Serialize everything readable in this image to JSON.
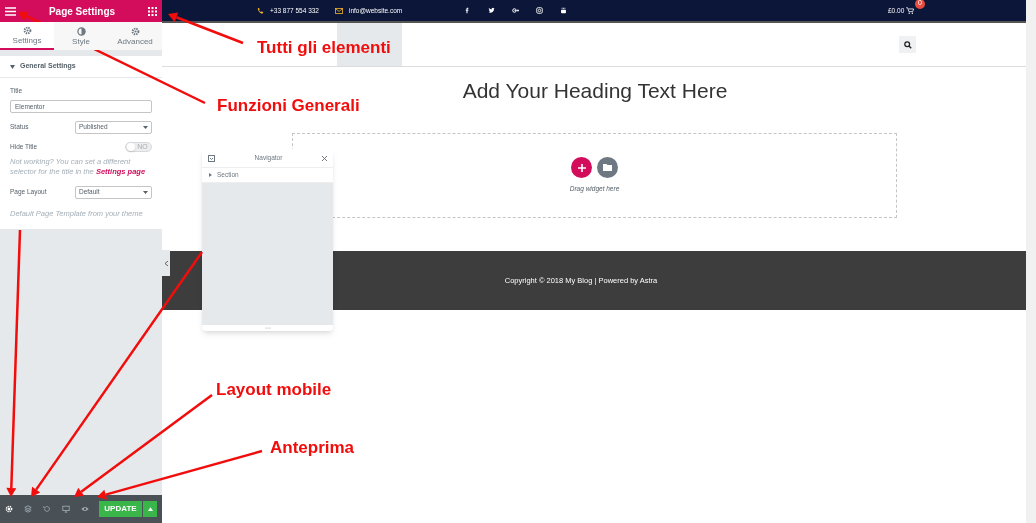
{
  "panel": {
    "title": "Page Settings",
    "tabs": [
      {
        "label": "Settings",
        "selected": true
      },
      {
        "label": "Style",
        "selected": false
      },
      {
        "label": "Advanced",
        "selected": false
      }
    ],
    "section_title": "General Settings",
    "fields": [
      {
        "kind": "text",
        "label": "Title",
        "value": "Elementor"
      },
      {
        "kind": "select",
        "label": "Status",
        "value": "Published"
      },
      {
        "kind": "toggle",
        "label": "Hide Title",
        "on": false,
        "toggle_text": "NO"
      },
      {
        "kind": "note",
        "text": "Not working? You can set a different selector for the title in the",
        "link": "Settings page"
      },
      {
        "kind": "select",
        "label": "Page Layout",
        "value": "Default"
      },
      {
        "kind": "hint",
        "text": "Default Page Template from your theme"
      }
    ]
  },
  "bottom_bar": {
    "update_label": "UPDATE"
  },
  "site": {
    "phone": "+33 877 554 332",
    "email": "info@website.com",
    "cart_total": "£0.00",
    "cart_count": "0",
    "heading": "Add Your Heading Text Here",
    "drop_hint": "Drag widget here",
    "footer": "Copyright © 2018 My Blog | Powered by Astra"
  },
  "navigator": {
    "title": "Navigator",
    "items": [
      "Section"
    ]
  },
  "annotations": [
    "Tutti gli elementi",
    "Funzioni Generali",
    "Layout mobile",
    "Anteprima"
  ]
}
